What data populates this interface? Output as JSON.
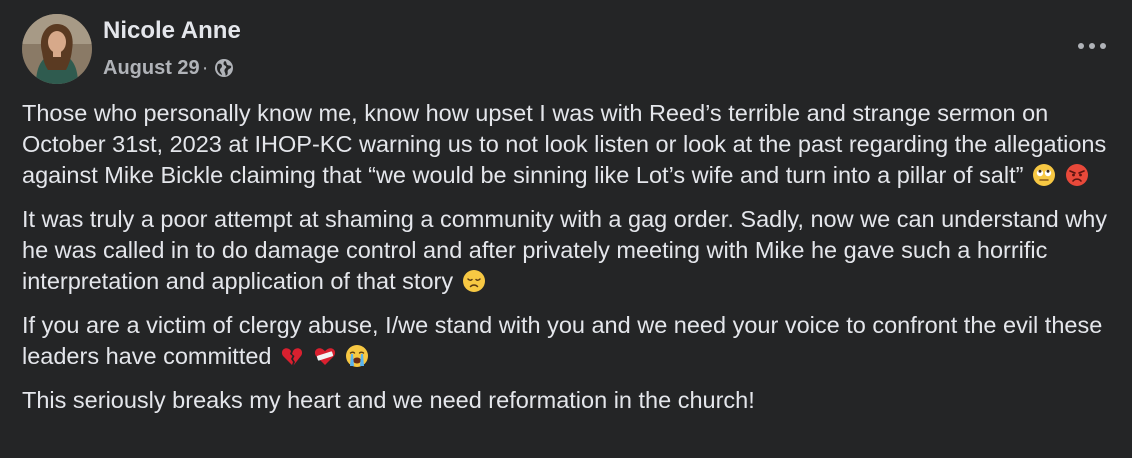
{
  "post": {
    "author": {
      "name": "Nicole Anne",
      "avatar_icon": "profile-photo"
    },
    "meta": {
      "date": "August 29",
      "separator": "·",
      "privacy_icon": "globe-icon"
    },
    "more_menu_icon": "ellipsis-icon",
    "paragraphs": [
      {
        "text": "Those who personally know me, know how upset I was with Reed’s terrible and strange sermon on October 31st, 2023 at IHOP-KC warning us to not look listen or look at the past regarding the allegations against Mike Bickle claiming that “we would be sinning like Lot’s wife and turn into a pillar of salt”",
        "emojis": [
          "face-with-rolling-eyes",
          "enraged-face"
        ]
      },
      {
        "text": "It was truly a poor attempt at shaming a community with a gag order. Sadly, now we can understand why he was called in to do damage control and after privately meeting with Mike he gave such a horrific interpretation and application of that story",
        "emojis": [
          "disappointed-face"
        ]
      },
      {
        "text": "If you are a victim of clergy abuse, I/we stand with you and we need your voice to confront the evil these leaders have committed",
        "emojis": [
          "broken-heart",
          "mending-heart",
          "loudly-crying-face"
        ]
      },
      {
        "text": "This seriously breaks my heart and we need reformation in the church!",
        "emojis": []
      }
    ]
  },
  "colors": {
    "background": "#242526",
    "primary_text": "#e4e6eb",
    "secondary_text": "#b0b3b8"
  }
}
